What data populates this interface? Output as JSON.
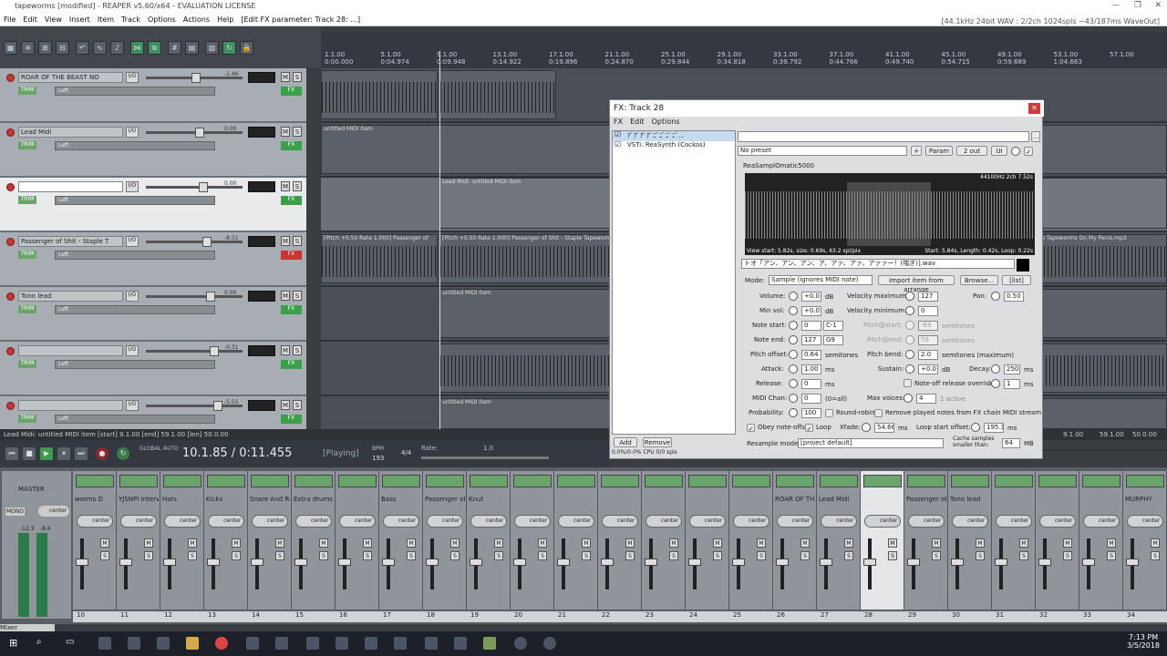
{
  "titlebar": {
    "title": "tapeworms [modified] - REAPER v5.60/x64 - EVALUATION LICENSE"
  },
  "menubar": {
    "items": [
      "File",
      "Edit",
      "View",
      "Insert",
      "Item",
      "Track",
      "Options",
      "Actions",
      "Help",
      "[Edit FX parameter: Track 28: ...]"
    ],
    "status": "[44.1kHz 24bit WAV : 2/2ch 1024spls ~43/187ms WaveOut]"
  },
  "ruler": {
    "ticks": [
      {
        "bar": "1.1.00",
        "time": "0:00.000"
      },
      {
        "bar": "5.1.00",
        "time": "0:04.974"
      },
      {
        "bar": "9.1.00",
        "time": "0:09.948"
      },
      {
        "bar": "13.1.00",
        "time": "0:14.922"
      },
      {
        "bar": "17.1.00",
        "time": "0:19.896"
      },
      {
        "bar": "21.1.00",
        "time": "0:24.870"
      },
      {
        "bar": "25.1.00",
        "time": "0:29.844"
      },
      {
        "bar": "29.1.00",
        "time": "0:34.818"
      },
      {
        "bar": "33.1.00",
        "time": "0:39.792"
      },
      {
        "bar": "37.1.00",
        "time": "0:44.766"
      },
      {
        "bar": "41.1.00",
        "time": "0:49.740"
      },
      {
        "bar": "45.1.00",
        "time": "0:54.715"
      },
      {
        "bar": "49.1.00",
        "time": "0:59.689"
      },
      {
        "bar": "53.1.00",
        "time": "1:04.663"
      },
      {
        "bar": "57.1.00",
        "time": ""
      }
    ]
  },
  "tracks": [
    {
      "name": "ROAR OF THE BEAST NO",
      "vol": "-1.46",
      "num": "26",
      "pan": "Left",
      "fx": "green",
      "sel": false
    },
    {
      "name": "Lead Midi",
      "vol": "0.00",
      "num": "27",
      "pan": "Left",
      "fx": "green",
      "sel": false
    },
    {
      "name": "",
      "vol": "0.00",
      "num": "28",
      "pan": "Left",
      "fx": "green",
      "sel": true
    },
    {
      "name": "Passenger of Shit - Staple T",
      "vol": "-8.51",
      "num": "29",
      "pan": "Left",
      "fx": "red",
      "sel": false
    },
    {
      "name": "Tono lead",
      "vol": "0.00",
      "num": "30",
      "pan": "Left",
      "fx": "green",
      "sel": false
    },
    {
      "name": "",
      "vol": "-0.31",
      "num": "31",
      "pan": "Left",
      "fx": "green",
      "sel": false
    },
    {
      "name": "",
      "vol": "-5.55",
      "num": "32",
      "pan": "Left",
      "fx": "green",
      "sel": false
    }
  ],
  "track_common": {
    "io": "I/O",
    "trim": "TRIM",
    "pan_mode": "center",
    "mute": "M",
    "solo": "S",
    "fx": "FX"
  },
  "items": {
    "lane27": "untitled MIDI item",
    "lane28": "Lead Midi: untitled MIDI item",
    "lane29a": "[Pitch +0.50 Rate 1.000] Passenger of",
    "lane29b": "[Pitch +0.50 Rate 1.000] Passenger of Shit - Staple Tapeworms",
    "lane29c": "Staple Tapeworms On My Penis.mp3",
    "lane30": "untitled MIDI item",
    "lane32": "untitled MIDI item"
  },
  "statusline": {
    "left": "Lead Midi: untitled MIDI item [start] 9.1.00 [end] 59.1.00 [len] 50.0.00",
    "right": [
      "9.1.00",
      "59.1.00",
      "50.0.00"
    ]
  },
  "transport": {
    "time": "10.1.85 / 0:11.455",
    "state": "[Playing]",
    "bpm_label": "BPM",
    "bpm": "193",
    "sig": "4/4",
    "rate_label": "Rate:",
    "rate": "1.0",
    "global_auto": "GLOBAL AUTO"
  },
  "fx_window": {
    "title": "FX: Track 28",
    "menu": [
      "FX",
      "Edit",
      "Options"
    ],
    "chain": [
      "ｱﾞｱﾞｱﾞｱﾞﾆﾞﾆﾞﾆﾞﾆﾞ...",
      "VSTi: ReaSynth (Cockos)"
    ],
    "add": "Add",
    "remove": "Remove",
    "cpu": "0.0%/0.0% CPU 0/0 spls",
    "preset": "No preset",
    "param": "Param",
    "out": "2 out",
    "ui": "UI",
    "plugin_name": "ReaSamplOmatic5000",
    "wave_info": "44100Hz 2ch 7.52s",
    "view_info": "View start: 5.82s, size: 0.69s, 63.2 spl/pix",
    "loop_info": "Start: 5.84s, Length: 0.42s, Loop: 0.22s",
    "file": "トオ「アン、アン、アン、ア、アァ、アァ、アァァー！(喘ぎ)].wav",
    "mode_label": "Mode:",
    "mode": "Sample (ignores MIDI note)",
    "import": "Import item from arrange",
    "browse": "Browse...",
    "list": "[list]",
    "volume_label": "Volume:",
    "volume": "+0.0",
    "db": "dB",
    "velmax_label": "Velocity maximum:",
    "velmax": "127",
    "pan_label": "Pan:",
    "pan": "0.50",
    "minvol_label": "Min vol:",
    "minvol": "+0.0",
    "velmin_label": "Velocity minimum:",
    "velmin": "0",
    "notestart_label": "Note start:",
    "notestart": "0",
    "notestart_n": "C-1",
    "pitchstart_label": "Pitch@start:",
    "pitchstart": "-69",
    "semitones": "semitones",
    "noteend_label": "Note end:",
    "noteend": "127",
    "noteend_n": "G9",
    "pitchend_label": "Pitch@end:",
    "pitchend": "59",
    "pitchoff_label": "Pitch offset:",
    "pitchoff": "0.64",
    "pitchbend_label": "Pitch bend:",
    "pitchbend": "2.0",
    "semimax": "semitones (maximum)",
    "attack_label": "Attack:",
    "attack": "1.00",
    "ms": "ms",
    "sustain_label": "Sustain:",
    "sustain": "+0.0",
    "decay_label": "Decay:",
    "decay": "250",
    "release_label": "Release:",
    "release": "0",
    "noteoff_label": "Note-off release override:",
    "noteoff": "1",
    "midichan_label": "MIDI Chan:",
    "midichan": "0",
    "midichan_note": "(0=all)",
    "maxvoices_label": "Max voices:",
    "maxvoices": "4",
    "active": "1 active",
    "prob_label": "Probability:",
    "prob": "100",
    "roundrobin": "Round-robin",
    "removeplayed": "Remove played notes from FX chain MIDI stream",
    "obey": "Obey note-offs",
    "loop": "Loop",
    "xfade_label": "Xfade:",
    "xfade": "54.66",
    "loopoff_label": "Loop start offset:",
    "loopoff": "195.1",
    "resample_label": "Resample mode:",
    "resample": "[project default]",
    "cache_label": "Cache samples smaller than:",
    "cache": "64",
    "mb": "MB"
  },
  "mixer": {
    "master": "MASTER",
    "mono": "MONO",
    "master_pan": "center",
    "master_meter": [
      "-12.3",
      "-8.6"
    ],
    "strips": [
      {
        "name": "worms D",
        "num": "10"
      },
      {
        "name": "YJSNPI Interv",
        "num": "11"
      },
      {
        "name": "Hats",
        "num": "12"
      },
      {
        "name": "Kicks",
        "num": "13"
      },
      {
        "name": "Snare And Ri",
        "num": "14"
      },
      {
        "name": "Extra drums",
        "num": "15"
      },
      {
        "name": "",
        "num": "16"
      },
      {
        "name": "Bass",
        "num": "17"
      },
      {
        "name": "Passenger of",
        "num": "18"
      },
      {
        "name": "Knut",
        "num": "19"
      },
      {
        "name": "",
        "num": "20"
      },
      {
        "name": "",
        "num": "21"
      },
      {
        "name": "",
        "num": "22"
      },
      {
        "name": "",
        "num": "23"
      },
      {
        "name": "",
        "num": "24"
      },
      {
        "name": "",
        "num": "25"
      },
      {
        "name": "ROAR OF TH",
        "num": "26"
      },
      {
        "name": "Lead Midi",
        "num": "27"
      },
      {
        "name": "",
        "num": "28"
      },
      {
        "name": "Passenger of",
        "num": "29"
      },
      {
        "name": "Tono lead",
        "num": "30"
      },
      {
        "name": "",
        "num": "31"
      },
      {
        "name": "",
        "num": "32"
      },
      {
        "name": "",
        "num": "33"
      },
      {
        "name": "MURPHY",
        "num": "34"
      }
    ],
    "pan": "center",
    "tab": "Mixer"
  },
  "taskbar": {
    "time": "7:13 PM",
    "date": "3/5/2018"
  }
}
